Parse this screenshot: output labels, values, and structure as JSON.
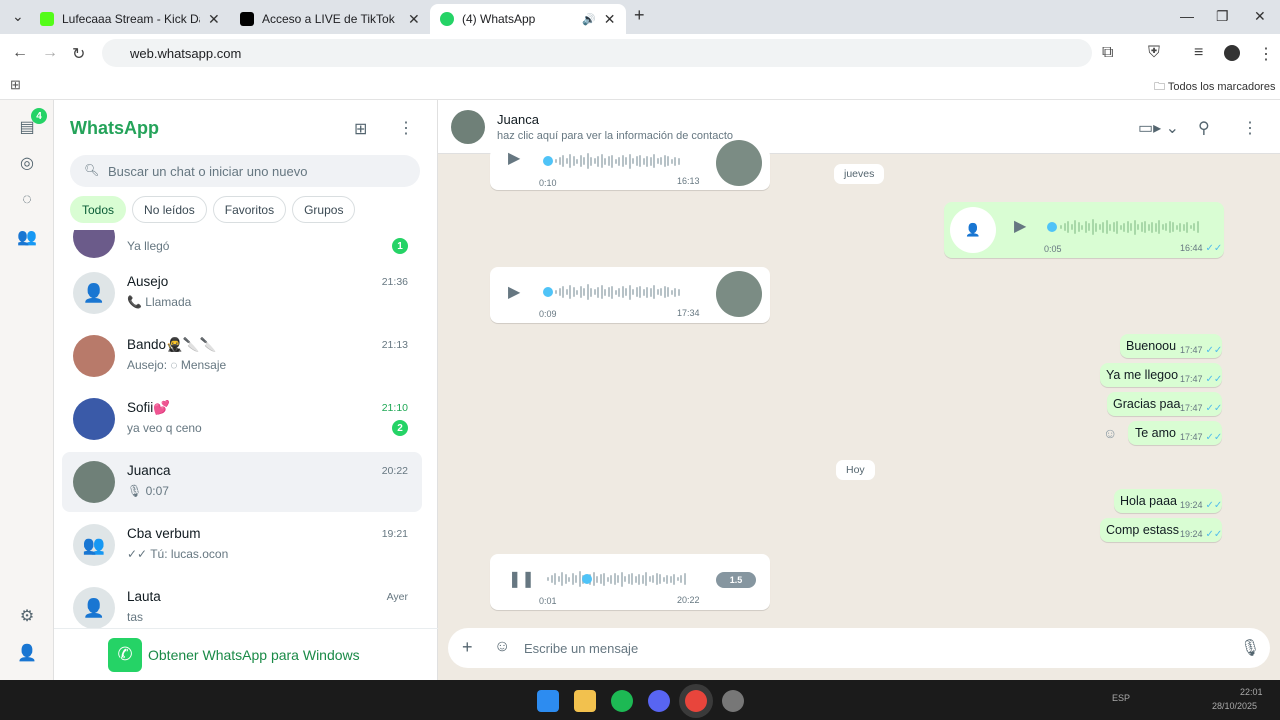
{
  "browser": {
    "tabs": [
      {
        "title": "Lufecaaa Stream - Kick Dashbo",
        "color": "#53fc18"
      },
      {
        "title": "Acceso a LIVE de TikTok",
        "color": "#000000"
      },
      {
        "title": "(4) WhatsApp",
        "color": "#25d366"
      }
    ],
    "url": "web.whatsapp.com",
    "bookmarks_label": "Todos los marcadores"
  },
  "rail": {
    "badge": "4"
  },
  "sidebar": {
    "brand": "WhatsApp",
    "search_placeholder": "Buscar un chat o iniciar uno nuevo",
    "chips": [
      "Todos",
      "No leídos",
      "Favoritos",
      "Grupos"
    ],
    "chats": [
      {
        "name": "",
        "preview": "Ya llegó",
        "time": "",
        "unread": "1"
      },
      {
        "name": "Ausejo",
        "preview": "📞 Llamada",
        "time": "21:36",
        "unread": ""
      },
      {
        "name": "Bando🥷🔪🔪",
        "preview": "Ausejo: ◌ Mensaje",
        "time": "21:13",
        "unread": ""
      },
      {
        "name": "Sofii💕",
        "preview": "ya veo q ceno",
        "time": "21:10",
        "unread": "2"
      },
      {
        "name": "Juanca",
        "preview": "🎙 0:07",
        "time": "20:22",
        "unread": ""
      },
      {
        "name": "Cba verbum",
        "preview": "✓✓ Tú: lucas.ocon",
        "time": "19:21",
        "unread": ""
      },
      {
        "name": "Lauta",
        "preview": "tas",
        "time": "Ayer",
        "unread": ""
      }
    ],
    "download": "Obtener WhatsApp para Windows"
  },
  "chat": {
    "name": "Juanca",
    "subtitle": "haz clic aquí para ver la información de contacto",
    "date_thursday": "jueves",
    "date_today": "Hoy",
    "voice": [
      {
        "dur": "0:10",
        "time": "16:13"
      },
      {
        "dur": "0:05",
        "time": "16:44"
      },
      {
        "dur": "0:09",
        "time": "17:34"
      },
      {
        "dur": "0:01",
        "time": "20:22",
        "speed": "1.5"
      }
    ],
    "messages": [
      {
        "text": "Buenoou",
        "time": "17:47"
      },
      {
        "text": "Ya me llegoo",
        "time": "17:47"
      },
      {
        "text": "Gracias paa",
        "time": "17:47"
      },
      {
        "text": "Te amo",
        "time": "17:47"
      },
      {
        "text": "Hola paaa",
        "time": "19:24"
      },
      {
        "text": "Comp estass",
        "time": "19:24"
      }
    ],
    "composer_placeholder": "Escribe un mensaje"
  },
  "taskbar": {
    "lang": "ESP",
    "time": "22:01",
    "date": "28/10/2025"
  }
}
